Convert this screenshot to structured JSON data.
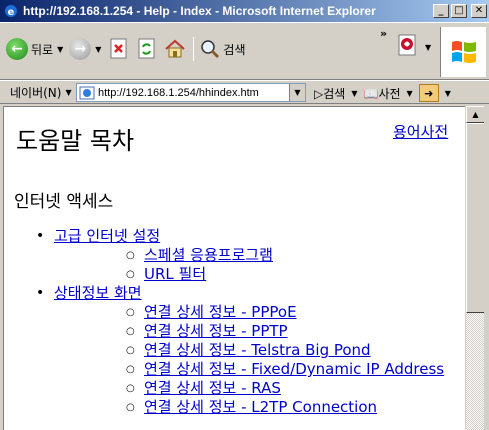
{
  "window": {
    "title": "http://192.168.1.254 - Help - Index - Microsoft Internet Explorer",
    "minimize": "_",
    "maximize": "□",
    "close": "✕"
  },
  "toolbar": {
    "back_label": "뒤로",
    "search_label": "검색",
    "chevron": "»"
  },
  "addressbar": {
    "naver_label": "네이버(N)",
    "url": "http://192.168.1.254/hhindex.htm",
    "search_label": "검색",
    "dict_label": "사전"
  },
  "content": {
    "page_title": "도움말 목차",
    "glossary_link": "용어사전",
    "section_heading": "인터넷 액세스",
    "toc": [
      {
        "label": "고급 인터넷 설정",
        "children": [
          "스페셜 응용프로그램",
          "URL 필터"
        ]
      },
      {
        "label": "상태정보 화면",
        "children": [
          "연결 상세 정보 - PPPoE",
          "연결 상세 정보 - PPTP",
          "연결 상세 정보 - Telstra Big Pond",
          "연결 상세 정보 - Fixed/Dynamic IP Address",
          "연결 상세 정보 - RAS",
          "연결 상세 정보 - L2TP Connection"
        ]
      }
    ]
  },
  "colors": {
    "titlebar_start": "#0a246a",
    "titlebar_end": "#a6caf0",
    "link": "#0000cc",
    "chrome": "#d4d0c8"
  }
}
